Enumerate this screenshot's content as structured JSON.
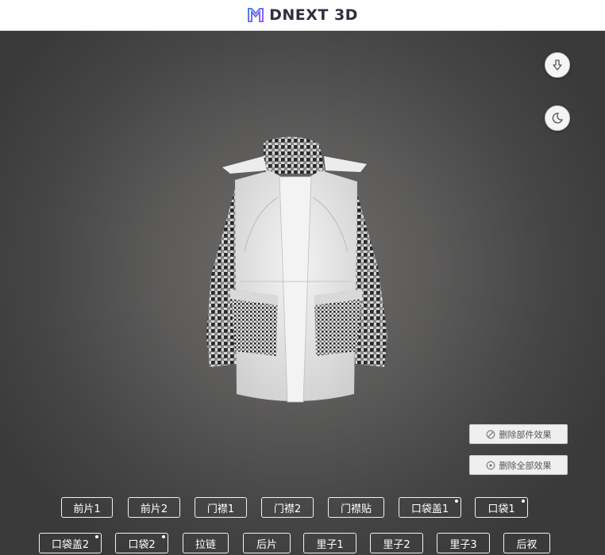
{
  "header": {
    "brand": "DNEXT 3D",
    "logo_icon": "dnext-logo-icon"
  },
  "viewer": {
    "icons": {
      "download": "arrow-down-icon",
      "theme": "moon-icon"
    },
    "garment": "3d-coat-model"
  },
  "actions": {
    "delete_part_effect": "删除部件效果",
    "delete_all_effects": "删除全部效果"
  },
  "parts_row1": [
    {
      "label": "前片1",
      "has_dot": false
    },
    {
      "label": "前片2",
      "has_dot": false
    },
    {
      "label": "门襟1",
      "has_dot": false
    },
    {
      "label": "门襟2",
      "has_dot": false
    },
    {
      "label": "门襟贴",
      "has_dot": false
    },
    {
      "label": "口袋盖1",
      "has_dot": true
    },
    {
      "label": "口袋1",
      "has_dot": true
    }
  ],
  "parts_row2": [
    {
      "label": "口袋盖2",
      "has_dot": true
    },
    {
      "label": "口袋2",
      "has_dot": true
    },
    {
      "label": "拉链",
      "has_dot": false
    },
    {
      "label": "后片",
      "has_dot": false
    },
    {
      "label": "里子1",
      "has_dot": false
    },
    {
      "label": "里子2",
      "has_dot": false
    },
    {
      "label": "里子3",
      "has_dot": false
    },
    {
      "label": "后衩",
      "has_dot": false
    }
  ],
  "colors": {
    "viewer_bg": "#5c5b5a",
    "logo_accent": "#8a5cf6",
    "logo_accent2": "#3b82f6"
  }
}
